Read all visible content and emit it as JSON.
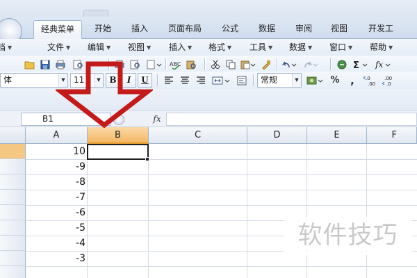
{
  "ribbon": {
    "tabs": [
      {
        "label": "经典菜单",
        "active": true
      },
      {
        "label": "开始"
      },
      {
        "label": "插入"
      },
      {
        "label": "页面布局"
      },
      {
        "label": "公式"
      },
      {
        "label": "数据"
      },
      {
        "label": "审阅"
      },
      {
        "label": "视图"
      },
      {
        "label": "开发工"
      }
    ]
  },
  "menubar": {
    "items": [
      {
        "label": "档"
      },
      {
        "label": "文件"
      },
      {
        "label": "编辑"
      },
      {
        "label": "视图"
      },
      {
        "label": "插入"
      },
      {
        "label": "格式"
      },
      {
        "label": "工具"
      },
      {
        "label": "数据"
      },
      {
        "label": "窗口"
      },
      {
        "label": "帮助"
      }
    ]
  },
  "format_toolbar": {
    "font_name": "体",
    "font_size": "11",
    "bold_label": "B",
    "italic_label": "I",
    "underline_label": "U",
    "number_format": "常规",
    "percent_label": "%",
    "comma_label": ","
  },
  "formula_bar": {
    "name_box": "B1",
    "fx_label": "fx",
    "formula": ""
  },
  "sheet": {
    "columns": [
      "A",
      "B",
      "C",
      "D",
      "E",
      "F"
    ],
    "selected_column": "B",
    "selected_cell": "B1",
    "column_a_values": [
      "10",
      "-9",
      "-8",
      "-7",
      "-6",
      "-5",
      "-4",
      "-3"
    ]
  },
  "watermark": "软件技巧",
  "colors": {
    "annotation_arrow": "#c41a1a",
    "selected_header": "#f7c37a",
    "ribbon_blue": "#d6e2f1"
  },
  "icons": [
    "office-button-icon",
    "open-folder-icon",
    "save-icon",
    "print-icon",
    "print-preview-icon",
    "spell-check-icon",
    "cut-icon",
    "copy-icon",
    "paste-icon",
    "format-painter-icon",
    "undo-icon",
    "redo-icon",
    "hyperlink-icon",
    "autosum-icon",
    "insert-function-icon",
    "align-left-icon",
    "align-center-icon",
    "align-right-icon",
    "merge-center-icon",
    "currency-icon",
    "increase-decimal-icon",
    "decrease-decimal-icon"
  ]
}
